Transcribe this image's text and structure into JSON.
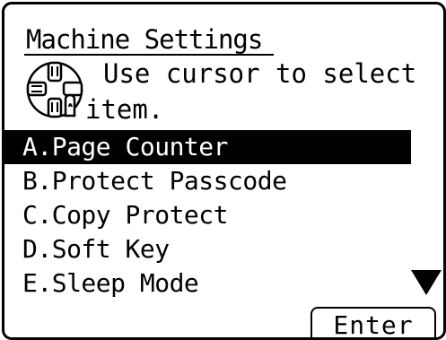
{
  "screen": {
    "title": "Machine Settings",
    "instruction_line1": "Use cursor to select",
    "instruction_line2": "item.",
    "cursor_icon": "cursor-keys-icon"
  },
  "menu": {
    "items": [
      {
        "label": "A.Page Counter",
        "selected": true
      },
      {
        "label": "B.Protect Passcode",
        "selected": false
      },
      {
        "label": "C.Copy Protect",
        "selected": false
      },
      {
        "label": "D.Soft Key",
        "selected": false
      },
      {
        "label": "E.Sleep Mode",
        "selected": false
      }
    ],
    "more_indicator_icon": "triangle-down-icon"
  },
  "softkey": {
    "enter_label": "Enter"
  },
  "colors": {
    "background": "#ffffff",
    "foreground": "#000000",
    "highlight_background": "#000000",
    "highlight_text": "#ffffff"
  }
}
